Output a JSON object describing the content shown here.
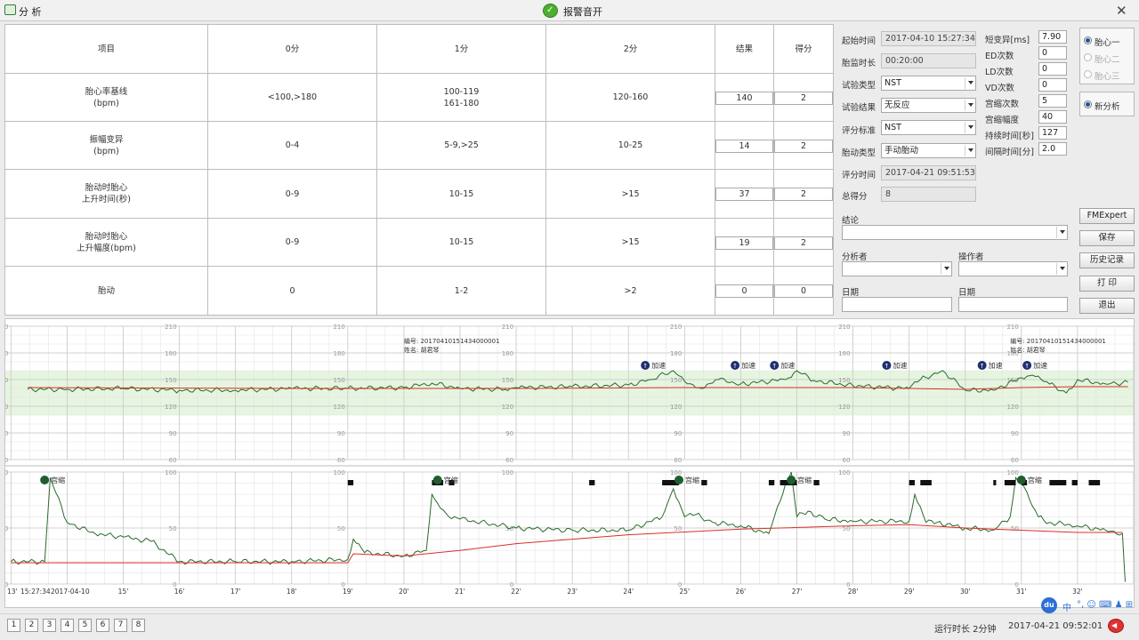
{
  "window": {
    "title": "分 析",
    "alarm_label": "报警音开",
    "close": "✕"
  },
  "table": {
    "headers": [
      "项目",
      "0分",
      "1分",
      "2分",
      "结果",
      "得分"
    ],
    "rows": [
      {
        "item": "胎心率基线\n(bpm)",
        "s0": "<100,>180",
        "s1": "100-119\n161-180",
        "s2": "120-160",
        "result": "140",
        "score": "2"
      },
      {
        "item": "振幅变异\n(bpm)",
        "s0": "0-4",
        "s1": "5-9,>25",
        "s2": "10-25",
        "result": "14",
        "score": "2"
      },
      {
        "item": "胎动时胎心\n上升时间(秒)",
        "s0": "0-9",
        "s1": "10-15",
        "s2": ">15",
        "result": "37",
        "score": "2"
      },
      {
        "item": "胎动时胎心\n上升幅度(bpm)",
        "s0": "0-9",
        "s1": "10-15",
        "s2": ">15",
        "result": "19",
        "score": "2"
      },
      {
        "item": "胎动",
        "s0": "0",
        "s1": "1-2",
        "s2": ">2",
        "result": "0",
        "score": "0"
      }
    ]
  },
  "form": {
    "start_label": "起始时间",
    "start_value": "2017-04-10 15:27:34",
    "duration_label": "胎监时长",
    "duration_value": "00:20:00",
    "test_type_label": "试验类型",
    "test_type_value": "NST",
    "test_result_label": "试验结果",
    "test_result_value": "无反应",
    "standard_label": "评分标准",
    "standard_value": "NST",
    "movement_type_label": "胎动类型",
    "movement_type_value": "手动胎动",
    "score_time_label": "评分时间",
    "score_time_value": "2017-04-21 09:51:53",
    "total_label": "总得分",
    "total_value": "8",
    "conclusion_label": "结论",
    "analyst_label": "分析者",
    "operator_label": "操作者",
    "date1_label": "日期",
    "date2_label": "日期"
  },
  "metrics": [
    {
      "label": "短变异[ms]",
      "value": "7.90"
    },
    {
      "label": "ED次数",
      "value": "0"
    },
    {
      "label": "LD次数",
      "value": "0"
    },
    {
      "label": "VD次数",
      "value": "0"
    },
    {
      "label": "宫缩次数",
      "value": "5"
    },
    {
      "label": "宫缩幅度",
      "value": "40"
    },
    {
      "label": "持续时间[秒]",
      "value": "127"
    },
    {
      "label": "间隔时间[分]",
      "value": "2.0"
    }
  ],
  "radios": {
    "fetus1": "胎心一",
    "fetus2": "胎心二",
    "fetus3": "胎心三",
    "new_analysis": "新分析"
  },
  "buttons": {
    "fmexpert": "FMExpert",
    "save": "保存",
    "history": "历史记录",
    "print": "打 印",
    "exit": "退出"
  },
  "chart_data": {
    "type": "line",
    "fhr": {
      "yticks": [
        60,
        90,
        120,
        150,
        180,
        210
      ],
      "ylim": [
        60,
        210
      ],
      "baseline_label_value": 140,
      "series": [
        {
          "name": "FHR",
          "color": "#2a6b2a",
          "x": [
            13.3,
            14,
            15,
            16,
            17,
            18,
            19,
            20,
            20.5,
            21,
            21.8,
            22,
            23,
            24,
            24.4,
            24.8,
            25,
            25.3,
            25.6,
            26,
            26.8,
            27,
            27.3,
            28,
            29,
            29.2,
            29.6,
            30,
            30.5,
            31,
            31.2,
            31.5,
            31.8,
            32,
            32.5,
            32.9
          ],
          "y": [
            139,
            139,
            140,
            138,
            138,
            140,
            140,
            141,
            146,
            140,
            139,
            141,
            142,
            144,
            150,
            160,
            148,
            140,
            150,
            145,
            150,
            160,
            149,
            143,
            140,
            150,
            160,
            138,
            138,
            152,
            155,
            145,
            135,
            150,
            145,
            147
          ]
        },
        {
          "name": "Baseline",
          "color": "#d8302a",
          "x": [
            13.3,
            18,
            22,
            25,
            28,
            29,
            30,
            31,
            32,
            32.9
          ],
          "y": [
            141,
            140,
            140,
            141,
            141,
            140,
            139,
            141,
            142,
            142
          ]
        }
      ],
      "accel_label": "加速",
      "accelerations_x": [
        24.3,
        25.9,
        26.6,
        28.6,
        30.3,
        31.1
      ],
      "record_id_label": "编号: 20170410151434000001",
      "patient_label": "姓名: 胡君琴",
      "record_label_x": [
        20.0,
        30.8
      ]
    },
    "toco": {
      "yticks": [
        0,
        50,
        100
      ],
      "ylim": [
        0,
        100
      ],
      "series": [
        {
          "name": "TOCO",
          "color": "#2a6b2a",
          "x": [
            13,
            13.6,
            13.7,
            14,
            14.5,
            15,
            15.5,
            16,
            17,
            18,
            19,
            19.1,
            19.3,
            20,
            20.4,
            20.5,
            20.6,
            20.8,
            21,
            22,
            23,
            24,
            24.6,
            24.8,
            25,
            25.2,
            25.5,
            26,
            26.5,
            26.8,
            26.9,
            27,
            27.2,
            27.5,
            28,
            29,
            29.1,
            29.3,
            29.5,
            30,
            30.5,
            30.8,
            30.9,
            31,
            31.3,
            31.5,
            32,
            32.5,
            32.8,
            32.85
          ],
          "y": [
            20,
            20,
            95,
            55,
            45,
            42,
            38,
            20,
            20,
            20,
            22,
            40,
            28,
            25,
            30,
            80,
            72,
            60,
            58,
            50,
            48,
            48,
            60,
            85,
            60,
            62,
            55,
            52,
            45,
            90,
            100,
            60,
            65,
            58,
            56,
            56,
            80,
            55,
            55,
            50,
            48,
            60,
            95,
            90,
            60,
            55,
            52,
            48,
            45,
            2
          ]
        },
        {
          "name": "Baseline",
          "color": "#d8302a",
          "x": [
            13,
            19,
            19.1,
            20,
            21,
            22,
            24,
            26,
            28,
            29,
            30,
            31,
            32,
            32.8
          ],
          "y": [
            19,
            19,
            27,
            25,
            30,
            36,
            44,
            49,
            52,
            53,
            50,
            48,
            46,
            46
          ]
        }
      ],
      "contraction_label": "宫缩",
      "contractions_x": [
        13.6,
        20.6,
        24.9,
        26.9,
        31.0
      ],
      "movement_marks": [
        [
          19.0,
          19.1
        ],
        [
          20.5,
          20.7
        ],
        [
          20.8,
          20.9
        ],
        [
          23.3,
          23.4
        ],
        [
          24.6,
          24.9
        ],
        [
          25.3,
          25.4
        ],
        [
          26.5,
          26.6
        ],
        [
          26.7,
          27.0
        ],
        [
          27.3,
          27.4
        ],
        [
          29.0,
          29.1
        ],
        [
          29.2,
          29.4
        ],
        [
          30.5,
          30.55
        ],
        [
          30.7,
          30.9
        ],
        [
          31.0,
          31.1
        ],
        [
          31.5,
          31.8
        ],
        [
          31.9,
          32.0
        ],
        [
          32.2,
          32.4
        ]
      ]
    },
    "xlim": [
      12.9,
      33.0
    ],
    "minute_ticks": [
      "15'",
      "16'",
      "17'",
      "18'",
      "19'",
      "20'",
      "21'",
      "22'",
      "23'",
      "24'",
      "25'",
      "26'",
      "27'",
      "28'",
      "29'",
      "30'",
      "31'",
      "32'"
    ],
    "start_tick": "13'",
    "start_time": "15:27:34",
    "start_date": "2017-04-10"
  },
  "pages": [
    "1",
    "2",
    "3",
    "4",
    "5",
    "6",
    "7",
    "8"
  ],
  "status": {
    "runtime": "运行时长 2分钟",
    "clock": "2017-04-21 09:52:01"
  },
  "ime": {
    "du": "du",
    "zh": "中",
    "items": "°, ☺ ⌨ ♟ ⊞"
  }
}
